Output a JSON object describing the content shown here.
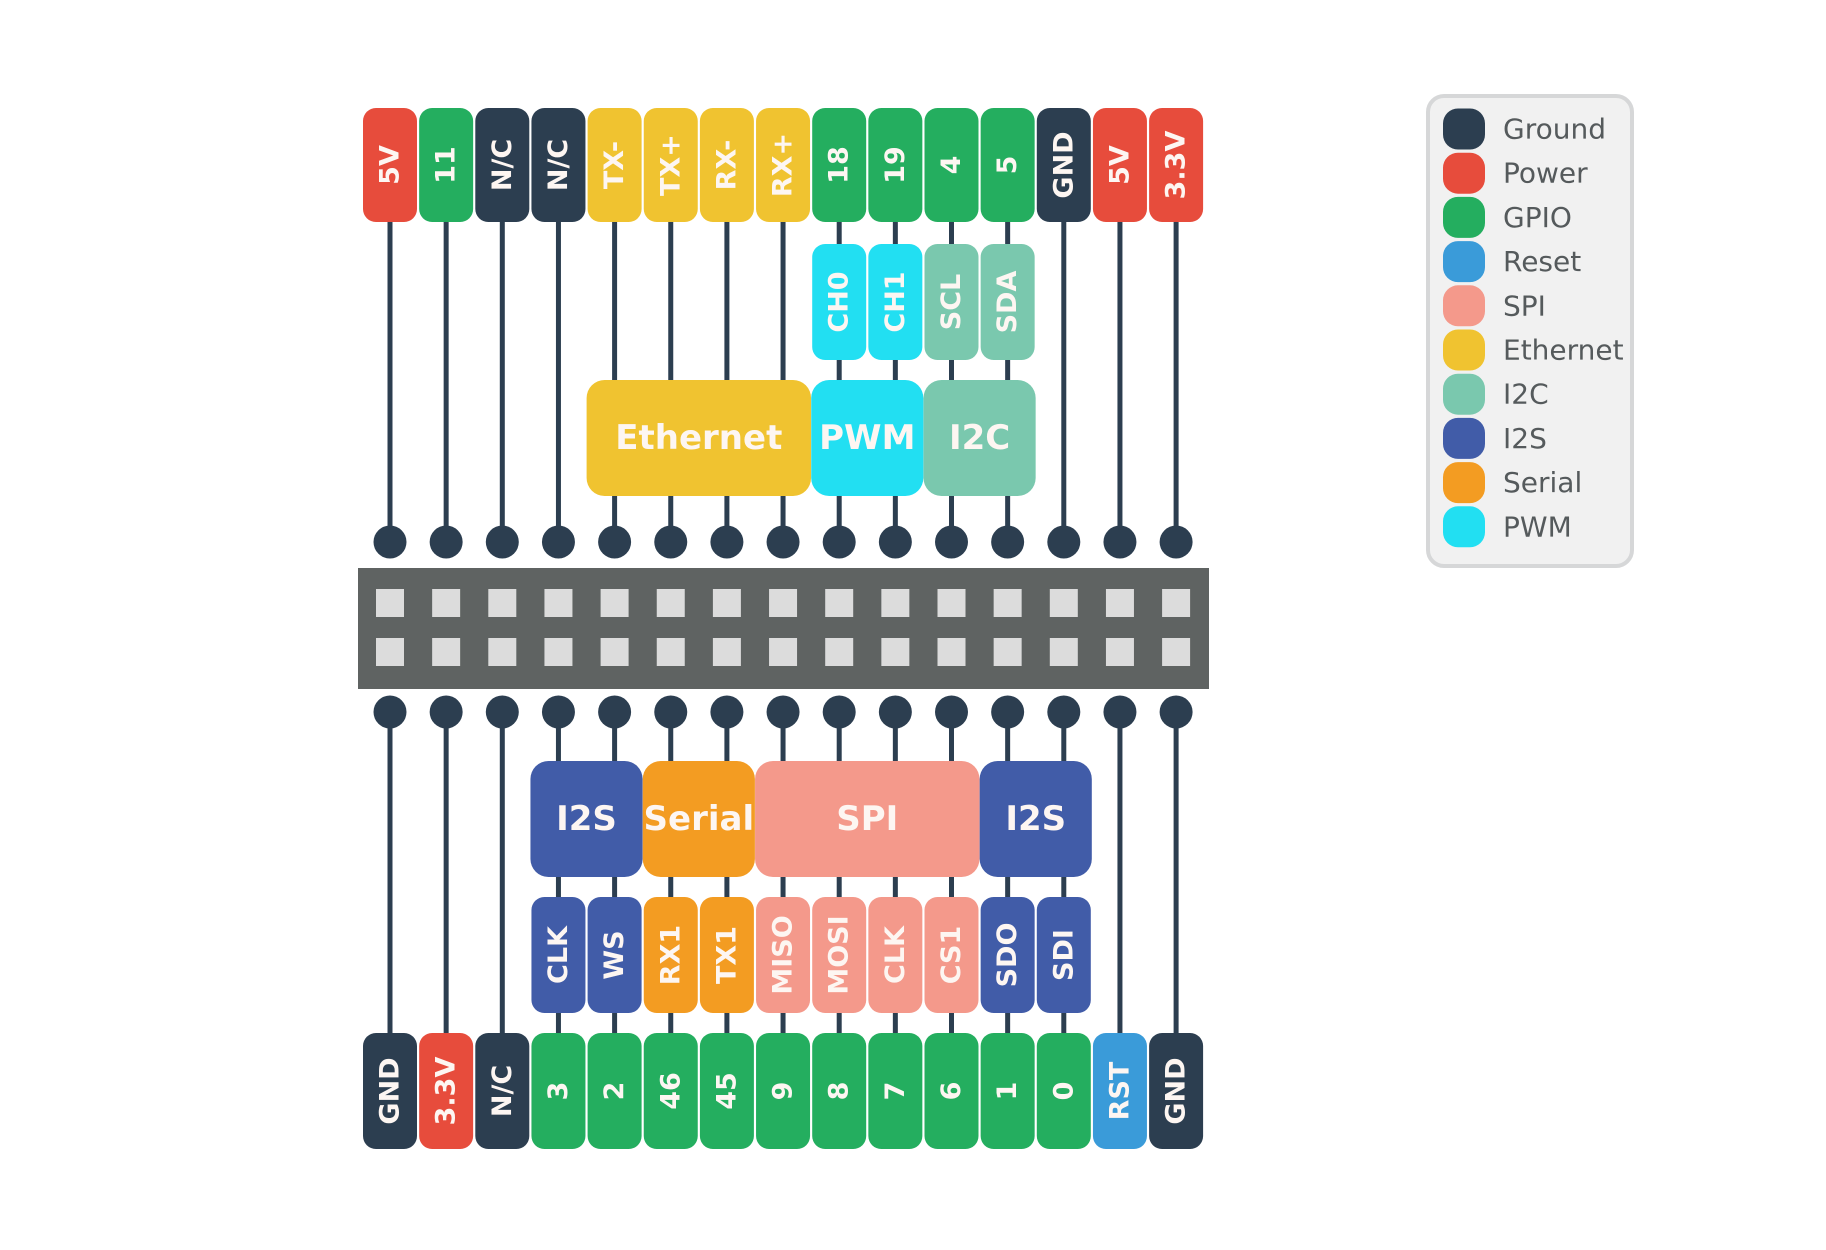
{
  "colors": {
    "ground": "#2c3e50",
    "power": "#e74c3c",
    "gpio": "#24ae5f",
    "reset": "#3a9bd9",
    "spi": "#f4998b",
    "ethernet": "#f0c330",
    "i2c": "#7ac8ae",
    "i2s": "#415ca8",
    "serial": "#f39c22",
    "pwm": "#22dff2",
    "wire": "#2c3e50",
    "header": "#5f6362",
    "header_pad": "#dcdcdc",
    "legend_bg": "#f1f1f1",
    "legend_border": "#d6d7d8"
  },
  "top_row": {
    "pins": [
      {
        "label": "5V",
        "type": "power"
      },
      {
        "label": "11",
        "type": "gpio"
      },
      {
        "label": "N/C",
        "type": "ground"
      },
      {
        "label": "N/C",
        "type": "ground"
      },
      {
        "label": "TX-",
        "type": "ethernet"
      },
      {
        "label": "TX+",
        "type": "ethernet"
      },
      {
        "label": "RX-",
        "type": "ethernet"
      },
      {
        "label": "RX+",
        "type": "ethernet"
      },
      {
        "label": "18",
        "type": "gpio"
      },
      {
        "label": "19",
        "type": "gpio"
      },
      {
        "label": "4",
        "type": "gpio"
      },
      {
        "label": "5",
        "type": "gpio"
      },
      {
        "label": "GND",
        "type": "ground"
      },
      {
        "label": "5V",
        "type": "power"
      },
      {
        "label": "3.3V",
        "type": "power"
      }
    ],
    "functions": [
      {
        "label": "CH0",
        "type": "pwm",
        "pin": 8
      },
      {
        "label": "CH1",
        "type": "pwm",
        "pin": 9
      },
      {
        "label": "SCL",
        "type": "i2c",
        "pin": 10
      },
      {
        "label": "SDA",
        "type": "i2c",
        "pin": 11
      }
    ],
    "groups": [
      {
        "label": "Ethernet",
        "type": "ethernet",
        "from": 4,
        "to": 7
      },
      {
        "label": "PWM",
        "type": "pwm",
        "from": 8,
        "to": 9
      },
      {
        "label": "I2C",
        "type": "i2c",
        "from": 10,
        "to": 11
      }
    ]
  },
  "bottom_row": {
    "pins": [
      {
        "label": "GND",
        "type": "ground"
      },
      {
        "label": "3.3V",
        "type": "power"
      },
      {
        "label": "N/C",
        "type": "ground"
      },
      {
        "label": "3",
        "type": "gpio"
      },
      {
        "label": "2",
        "type": "gpio"
      },
      {
        "label": "46",
        "type": "gpio"
      },
      {
        "label": "45",
        "type": "gpio"
      },
      {
        "label": "9",
        "type": "gpio"
      },
      {
        "label": "8",
        "type": "gpio"
      },
      {
        "label": "7",
        "type": "gpio"
      },
      {
        "label": "6",
        "type": "gpio"
      },
      {
        "label": "1",
        "type": "gpio"
      },
      {
        "label": "0",
        "type": "gpio"
      },
      {
        "label": "RST",
        "type": "reset"
      },
      {
        "label": "GND",
        "type": "ground"
      }
    ],
    "functions": [
      {
        "label": "CLK",
        "type": "i2s",
        "pin": 3
      },
      {
        "label": "WS",
        "type": "i2s",
        "pin": 4
      },
      {
        "label": "RX1",
        "type": "serial",
        "pin": 5
      },
      {
        "label": "TX1",
        "type": "serial",
        "pin": 6
      },
      {
        "label": "MISO",
        "type": "spi",
        "pin": 7
      },
      {
        "label": "MOSI",
        "type": "spi",
        "pin": 8
      },
      {
        "label": "CLK",
        "type": "spi",
        "pin": 9
      },
      {
        "label": "CS1",
        "type": "spi",
        "pin": 10
      },
      {
        "label": "SDO",
        "type": "i2s",
        "pin": 11
      },
      {
        "label": "SDI",
        "type": "i2s",
        "pin": 12
      }
    ],
    "groups": [
      {
        "label": "I2S",
        "type": "i2s",
        "from": 3,
        "to": 4
      },
      {
        "label": "Serial",
        "type": "serial",
        "from": 5,
        "to": 6
      },
      {
        "label": "SPI",
        "type": "spi",
        "from": 7,
        "to": 10
      },
      {
        "label": "I2S",
        "type": "i2s",
        "from": 11,
        "to": 12
      }
    ]
  },
  "legend": {
    "items": [
      {
        "label": "Ground",
        "type": "ground"
      },
      {
        "label": "Power",
        "type": "power"
      },
      {
        "label": "GPIO",
        "type": "gpio"
      },
      {
        "label": "Reset",
        "type": "reset"
      },
      {
        "label": "SPI",
        "type": "spi"
      },
      {
        "label": "Ethernet",
        "type": "ethernet"
      },
      {
        "label": "I2C",
        "type": "i2c"
      },
      {
        "label": "I2S",
        "type": "i2s"
      },
      {
        "label": "Serial",
        "type": "serial"
      },
      {
        "label": "PWM",
        "type": "pwm"
      }
    ]
  }
}
